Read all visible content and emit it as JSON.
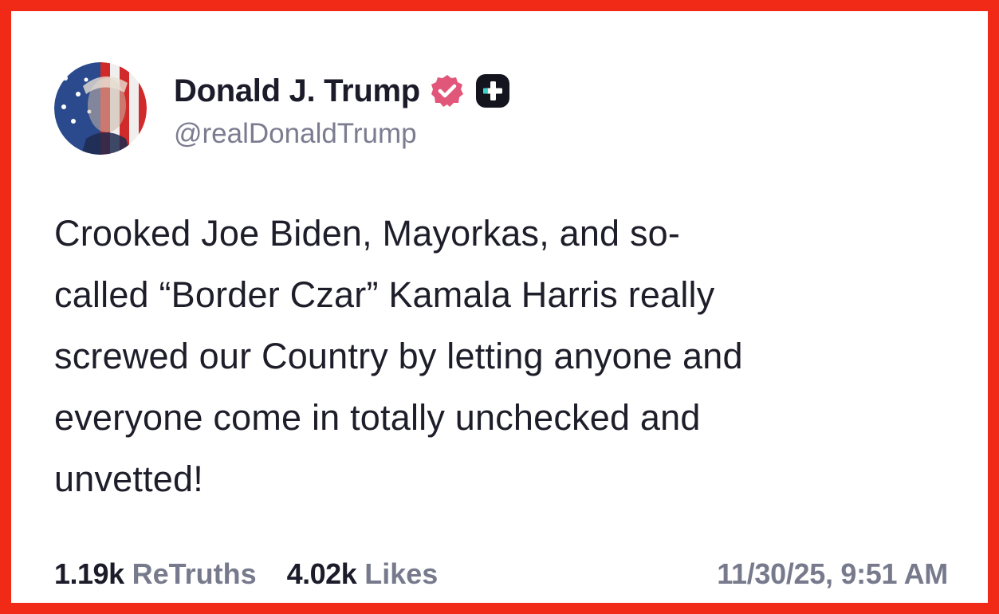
{
  "author": {
    "display_name": "Donald J. Trump",
    "handle": "@realDonaldTrump",
    "avatar_icon": "flag-portrait-avatar",
    "verified_icon": "verified-badge-icon",
    "extra_icon": "plus-badge-icon"
  },
  "post": {
    "lines": [
      "Crooked Joe Biden, Mayorkas, and so-",
      "called “Border Czar” Kamala Harris really",
      "screwed our Country by letting anyone and",
      "everyone come in totally unchecked and",
      "unvetted!"
    ]
  },
  "stats": {
    "retruths_count": "1.19k",
    "retruths_label": "ReTruths",
    "likes_count": "4.02k",
    "likes_label": "Likes"
  },
  "timestamp": "11/30/25, 9:51 AM",
  "colors": {
    "frame_border": "#f02a17",
    "verified_badge": "#e0577a",
    "plus_badge": "#14141f",
    "muted_text": "#777a8c"
  }
}
